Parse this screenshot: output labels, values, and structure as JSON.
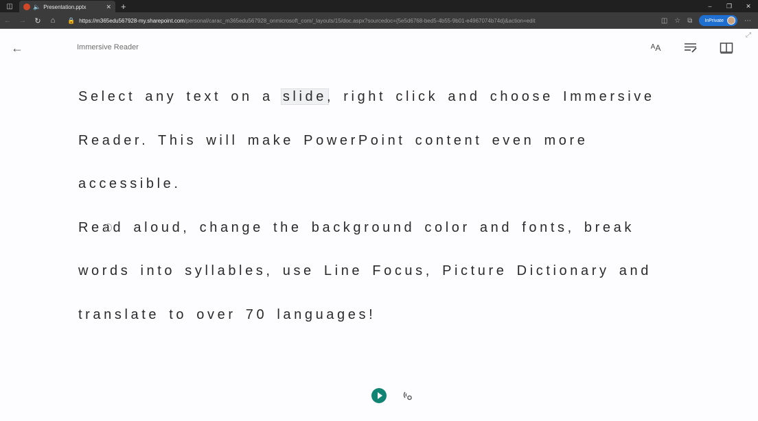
{
  "browser": {
    "tab": {
      "title": "Presentation.pptx"
    },
    "url": {
      "scheme": "https://",
      "host": "m365edu567928-my.sharepoint.com",
      "path": "/personal/carac_m365edu567928_onmicrosoft_com/_layouts/15/doc.aspx?sourcedoc={5e5d6768-bed5-4b55-9b01-e4967074b74d}&action=edit"
    },
    "inprivate_label": "InPrivate",
    "window_controls": {
      "minimize": "–",
      "maximize": "❐",
      "close": "✕"
    }
  },
  "reader": {
    "title": "Immersive Reader",
    "toolbar": {
      "text_preferences": "text-preferences-icon",
      "grammar_options": "grammar-options-icon",
      "reading_preferences": "reading-preferences-icon"
    },
    "paragraphs": [
      {
        "before": "Select any text on a ",
        "highlight": "slide",
        "after": ", right click and choose Immersive Reader. This will make PowerPoint content even more accessible."
      },
      {
        "before": "Read aloud, change the background color and fonts, break words into syllables, use Line Focus, Picture Dictionary and translate to over 70 languages!",
        "highlight": "",
        "after": ""
      }
    ],
    "accent_color": "#118474"
  }
}
